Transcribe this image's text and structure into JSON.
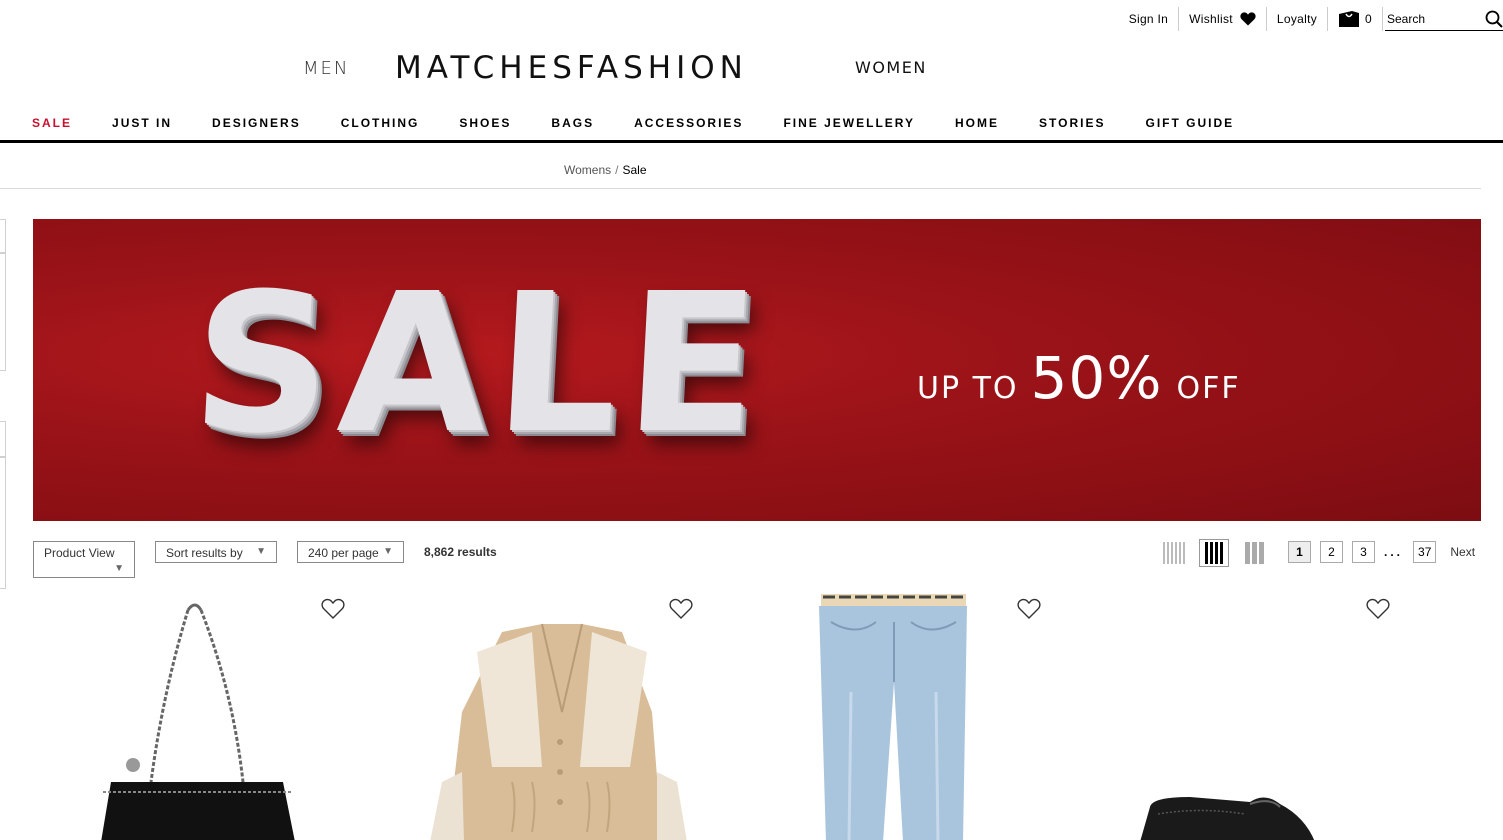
{
  "utility": {
    "sign_in": "Sign In",
    "wishlist": "Wishlist",
    "loyalty": "Loyalty",
    "bag_count": "0",
    "search_placeholder": "Search"
  },
  "brand": {
    "men": "MEN",
    "logo": "MATCHESFASHION",
    "women": "WOMEN"
  },
  "nav": [
    "SALE",
    "JUST IN",
    "DESIGNERS",
    "CLOTHING",
    "SHOES",
    "BAGS",
    "ACCESSORIES",
    "FINE JEWELLERY",
    "HOME",
    "STORIES",
    "GIFT GUIDE"
  ],
  "breadcrumb": {
    "parent": "Womens",
    "separator": "/",
    "current": "Sale"
  },
  "banner": {
    "headline": "SALE",
    "offer_prefix": "UP TO",
    "offer_value": "50%",
    "offer_suffix": "OFF",
    "bg_color": "#9a1318"
  },
  "toolbar": {
    "product_view": "Product View",
    "sort": "Sort results by",
    "per_page": "240 per page",
    "results": "8,862 results"
  },
  "pagination": {
    "pages": [
      "1",
      "2",
      "3"
    ],
    "ellipsis": "...",
    "last": "37",
    "next": "Next"
  },
  "products": [
    {
      "icon": "tote-bag-image"
    },
    {
      "icon": "knit-cardigan-image"
    },
    {
      "icon": "jeans-image"
    },
    {
      "icon": "brogue-shoe-image"
    }
  ],
  "colors": {
    "sale_red": "#c8102e",
    "text": "#000000"
  }
}
